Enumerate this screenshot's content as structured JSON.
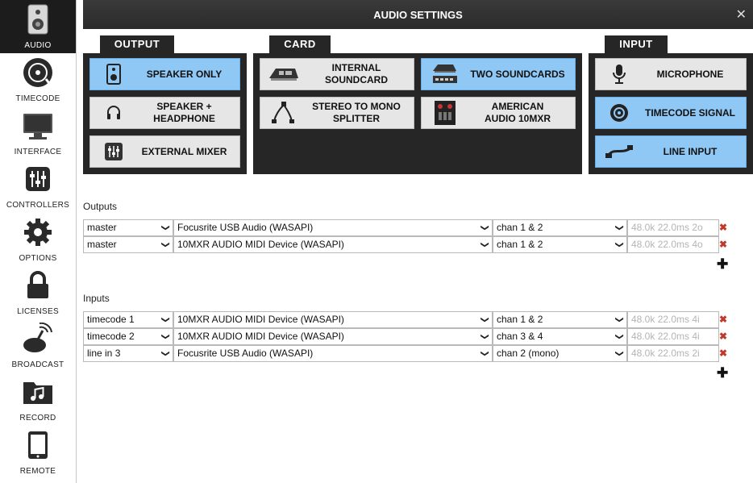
{
  "sidebar": {
    "items": [
      {
        "label": "AUDIO",
        "icon": "speaker-icon"
      },
      {
        "label": "TIMECODE",
        "icon": "vinyl-icon"
      },
      {
        "label": "INTERFACE",
        "icon": "monitor-icon"
      },
      {
        "label": "CONTROLLERS",
        "icon": "sliders-icon"
      },
      {
        "label": "OPTIONS",
        "icon": "gear-icon"
      },
      {
        "label": "LICENSES",
        "icon": "lock-icon"
      },
      {
        "label": "BROADCAST",
        "icon": "broadcast-icon"
      },
      {
        "label": "RECORD",
        "icon": "music-folder-icon"
      },
      {
        "label": "REMOTE",
        "icon": "tablet-icon"
      }
    ]
  },
  "header": {
    "title": "AUDIO SETTINGS",
    "close": "✕"
  },
  "output": {
    "tab": "OUTPUT",
    "buttons": [
      {
        "label": "SPEAKER ONLY",
        "icon": "speaker-icon",
        "selected": true
      },
      {
        "label": "SPEAKER +\nHEADPHONE",
        "icon": "headphone-icon",
        "selected": false
      },
      {
        "label": "EXTERNAL MIXER",
        "icon": "mixer-icon",
        "selected": false
      }
    ]
  },
  "card": {
    "tab": "CARD",
    "buttons": [
      {
        "label": "INTERNAL\nSOUNDCARD",
        "icon": "soundcard-icon",
        "selected": false
      },
      {
        "label": "TWO SOUNDCARDS",
        "icon": "two-soundcards-icon",
        "selected": true
      },
      {
        "label": "STEREO TO MONO\nSPLITTER",
        "icon": "splitter-cable-icon",
        "selected": false
      },
      {
        "label": "AMERICAN\nAUDIO 10MXR",
        "icon": "dj-mixer-device-icon",
        "selected": false
      }
    ]
  },
  "input": {
    "tab": "INPUT",
    "buttons": [
      {
        "label": "MICROPHONE",
        "icon": "microphone-icon",
        "selected": false
      },
      {
        "label": "TIMECODE SIGNAL",
        "icon": "timecode-disc-icon",
        "selected": true
      },
      {
        "label": "LINE INPUT",
        "icon": "line-cable-icon",
        "selected": true
      }
    ]
  },
  "outputs": {
    "label": "Outputs",
    "rows": [
      {
        "channel": "master",
        "device": "Focusrite USB Audio (WASAPI)",
        "chan": "chan 1 & 2",
        "info": "48.0k 22.0ms 2o"
      },
      {
        "channel": "master",
        "device": "10MXR AUDIO MIDI Device (WASAPI)",
        "chan": "chan 1 & 2",
        "info": "48.0k 22.0ms 4o"
      }
    ]
  },
  "inputs": {
    "label": "Inputs",
    "rows": [
      {
        "channel": "timecode 1",
        "device": "10MXR AUDIO MIDI Device (WASAPI)",
        "chan": "chan 1 & 2",
        "info": "48.0k 22.0ms 4i"
      },
      {
        "channel": "timecode 2",
        "device": "10MXR AUDIO MIDI Device (WASAPI)",
        "chan": "chan 3 & 4",
        "info": "48.0k 22.0ms 4i"
      },
      {
        "channel": "line in 3",
        "device": "Focusrite USB Audio (WASAPI)",
        "chan": "chan 2 (mono)",
        "info": "48.0k 22.0ms 2i"
      }
    ]
  },
  "symbols": {
    "delete": "✖",
    "add": "✚"
  },
  "colors": {
    "selected": "#8fc8f5",
    "panel": "#262626",
    "delete": "#c0392b"
  }
}
